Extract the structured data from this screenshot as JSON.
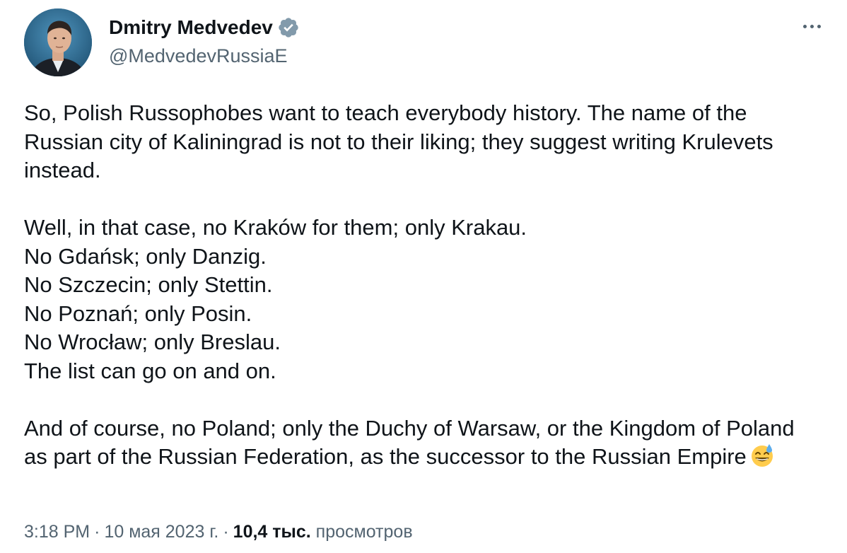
{
  "author": {
    "display_name": "Dmitry Medvedev",
    "handle": "@MedvedevRussiaE",
    "verified_icon": "verified-badge-icon",
    "avatar": "avatar-photo"
  },
  "actions": {
    "more_icon": "more-options-icon"
  },
  "tweet": {
    "paragraphs": [
      [
        "So, Polish Russophobes want to teach everybody history. The name of the Russian city of Kaliningrad is not to their liking; they suggest writing Krulevets instead."
      ],
      [
        "Well, in that case, no Kraków for them; only Krakau.",
        "No Gdańsk; only Danzig.",
        "No Szczecin; only Stettin.",
        "No Poznań; only Posin.",
        "No Wrocław; only Breslau.",
        "The list can go on and on."
      ],
      [
        "And of course, no Poland; only the Duchy of Warsaw, or the Kingdom of Poland as part of the Russian Federation, as the successor to the Russian Empire"
      ]
    ],
    "emoji": "grinning-sweat-emoji"
  },
  "meta": {
    "time": "3:18 PM",
    "separator": "·",
    "date": "10 мая 2023 г.",
    "views_count": "10,4 тыс.",
    "views_label": "просмотров"
  },
  "colors": {
    "text_primary": "#0f1419",
    "text_secondary": "#536471",
    "verified_blue": "#829aab"
  }
}
